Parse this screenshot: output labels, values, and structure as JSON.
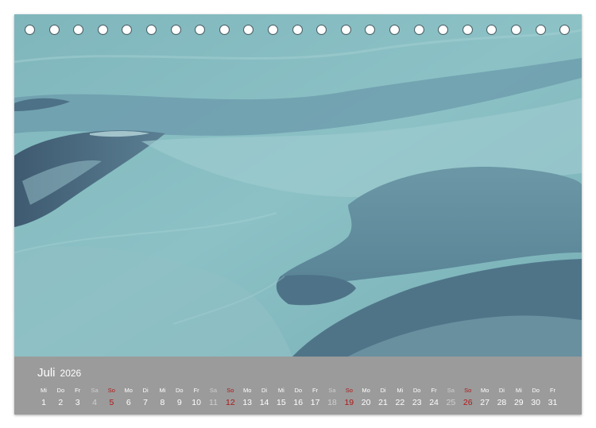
{
  "calendar": {
    "month": "Juli",
    "year": "2026",
    "colors": {
      "weekday": "#ffffff",
      "saturday": "#cfcfcf",
      "sunday": "#b01818",
      "bar": "#9b9b9b"
    },
    "days": [
      {
        "wd": "Mi",
        "n": "1",
        "type": "weekday"
      },
      {
        "wd": "Do",
        "n": "2",
        "type": "weekday"
      },
      {
        "wd": "Fr",
        "n": "3",
        "type": "weekday"
      },
      {
        "wd": "Sa",
        "n": "4",
        "type": "sat"
      },
      {
        "wd": "So",
        "n": "5",
        "type": "sun"
      },
      {
        "wd": "Mo",
        "n": "6",
        "type": "weekday"
      },
      {
        "wd": "Di",
        "n": "7",
        "type": "weekday"
      },
      {
        "wd": "Mi",
        "n": "8",
        "type": "weekday"
      },
      {
        "wd": "Do",
        "n": "9",
        "type": "weekday"
      },
      {
        "wd": "Fr",
        "n": "10",
        "type": "weekday"
      },
      {
        "wd": "Sa",
        "n": "11",
        "type": "sat"
      },
      {
        "wd": "So",
        "n": "12",
        "type": "sun"
      },
      {
        "wd": "Mo",
        "n": "13",
        "type": "weekday"
      },
      {
        "wd": "Di",
        "n": "14",
        "type": "weekday"
      },
      {
        "wd": "Mi",
        "n": "15",
        "type": "weekday"
      },
      {
        "wd": "Do",
        "n": "16",
        "type": "weekday"
      },
      {
        "wd": "Fr",
        "n": "17",
        "type": "weekday"
      },
      {
        "wd": "Sa",
        "n": "18",
        "type": "sat"
      },
      {
        "wd": "So",
        "n": "19",
        "type": "sun"
      },
      {
        "wd": "Mo",
        "n": "20",
        "type": "weekday"
      },
      {
        "wd": "Di",
        "n": "21",
        "type": "weekday"
      },
      {
        "wd": "Mi",
        "n": "22",
        "type": "weekday"
      },
      {
        "wd": "Do",
        "n": "23",
        "type": "weekday"
      },
      {
        "wd": "Fr",
        "n": "24",
        "type": "weekday"
      },
      {
        "wd": "Sa",
        "n": "25",
        "type": "sat"
      },
      {
        "wd": "So",
        "n": "26",
        "type": "sun"
      },
      {
        "wd": "Mo",
        "n": "27",
        "type": "weekday"
      },
      {
        "wd": "Di",
        "n": "28",
        "type": "weekday"
      },
      {
        "wd": "Mi",
        "n": "29",
        "type": "weekday"
      },
      {
        "wd": "Do",
        "n": "30",
        "type": "weekday"
      },
      {
        "wd": "Fr",
        "n": "31",
        "type": "weekday"
      }
    ]
  }
}
